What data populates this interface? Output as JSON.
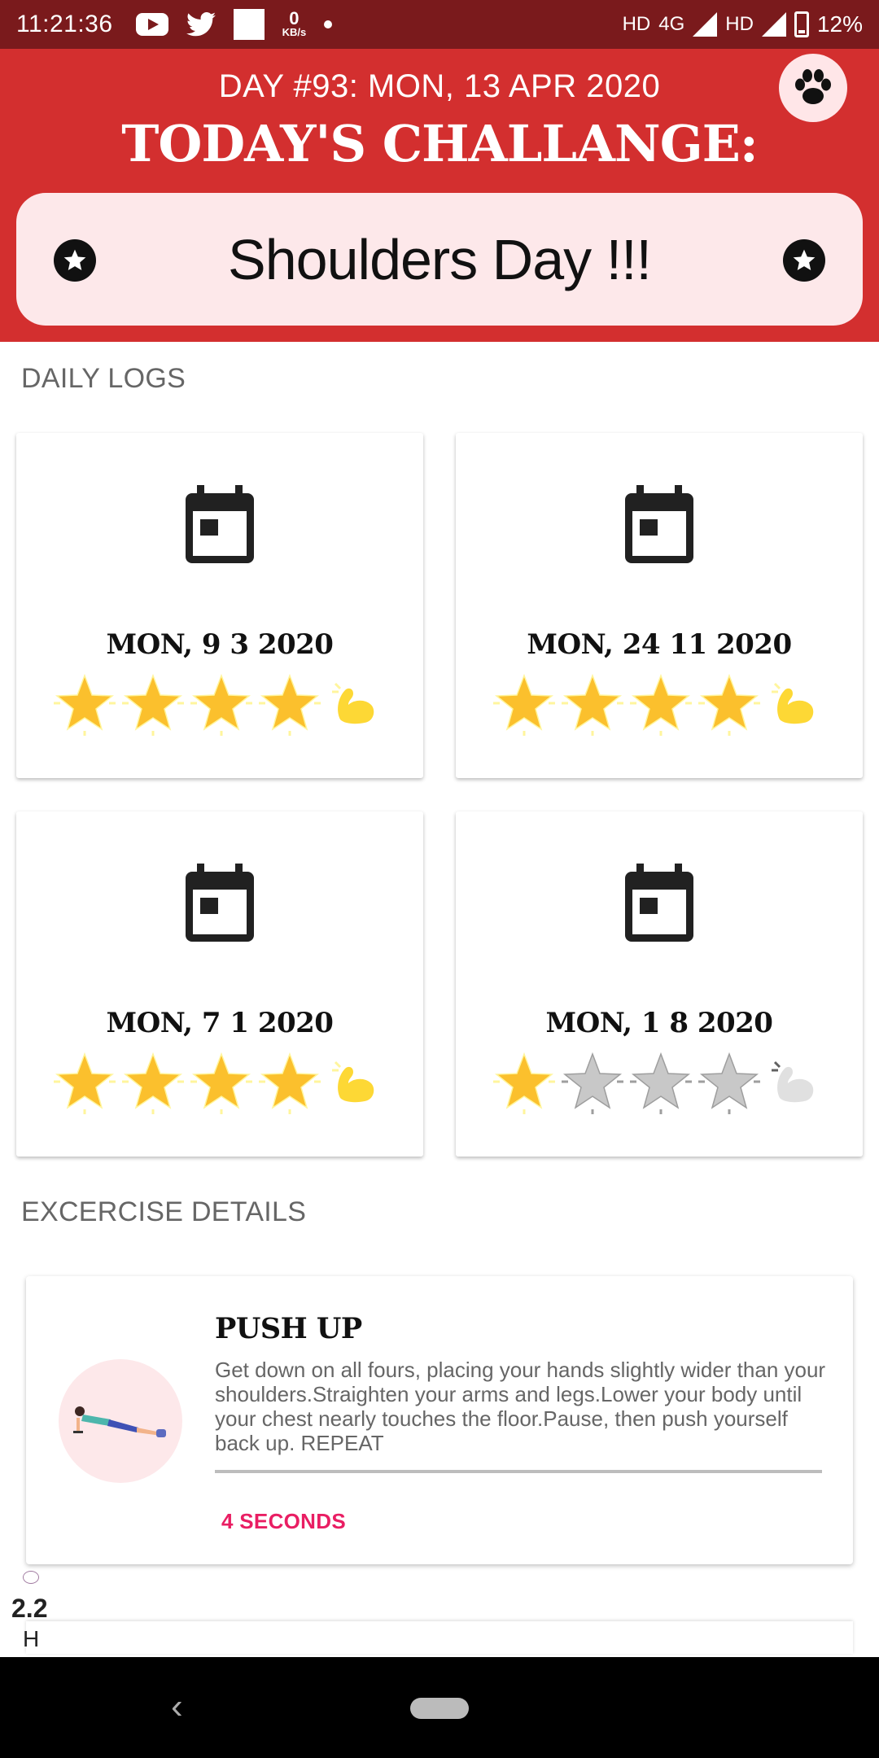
{
  "status_bar": {
    "time": "11:21:36",
    "net_speed_value": "0",
    "net_speed_unit": "KB/s",
    "network_label_1": "HD",
    "network_label_2": "4G",
    "network_label_3": "HD",
    "battery": "12%"
  },
  "header": {
    "day_line": "DAY #93: MON, 13 APR 2020",
    "title": "TODAY'S CHALLANGE:",
    "challenge": "Shoulders Day !!!",
    "colors": {
      "header_bg": "#d32f2f",
      "card_bg": "#fde8ea"
    }
  },
  "daily_logs": {
    "section_title": "DAILY LOGS",
    "items": [
      {
        "date": "MON, 9 3 2020",
        "rating": 4,
        "max_rating": 4,
        "achieved": true
      },
      {
        "date": "MON, 24 11 2020",
        "rating": 4,
        "max_rating": 4,
        "achieved": true
      },
      {
        "date": "MON, 7 1 2020",
        "rating": 4,
        "max_rating": 4,
        "achieved": true
      },
      {
        "date": "MON, 1 8 2020",
        "rating": 1,
        "max_rating": 4,
        "achieved": false
      }
    ]
  },
  "exercise": {
    "section_title": "EXCERCISE DETAILS",
    "name": "PUSH UP",
    "description": "Get down on all fours, placing your hands slightly wider than your shoulders.Straighten your arms and legs.Lower your body until your chest nearly touches the floor.Pause, then push yourself back up. REPEAT",
    "duration": "4 SECONDS",
    "icon": "push-up-figure"
  },
  "overlay": {
    "value": "2.2",
    "unit": "H"
  },
  "icons": {
    "header_button": "paw-icon",
    "challenge_decor": "star-circle-icon",
    "log_icon": "calendar-icon",
    "rating_icon": "star-icon",
    "achievement_icon": "flexed-bicep-icon"
  }
}
